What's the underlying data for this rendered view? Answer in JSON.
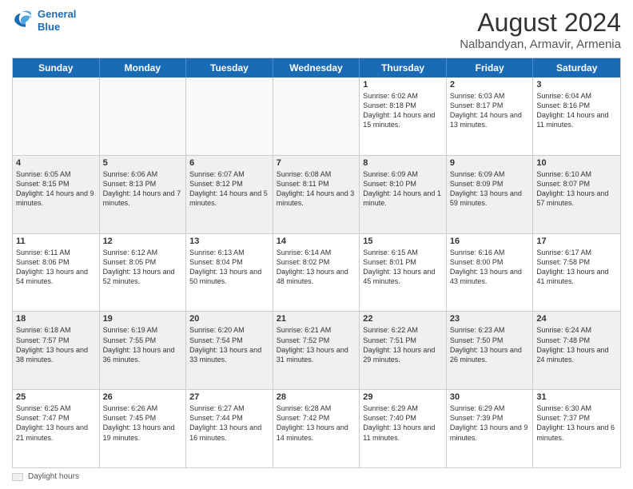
{
  "logo": {
    "line1": "General",
    "line2": "Blue"
  },
  "title": "August 2024",
  "subtitle": "Nalbandyan, Armavir, Armenia",
  "days_of_week": [
    "Sunday",
    "Monday",
    "Tuesday",
    "Wednesday",
    "Thursday",
    "Friday",
    "Saturday"
  ],
  "footer": {
    "daylight_label": "Daylight hours"
  },
  "weeks": [
    [
      {
        "day": "",
        "text": "",
        "empty": true
      },
      {
        "day": "",
        "text": "",
        "empty": true
      },
      {
        "day": "",
        "text": "",
        "empty": true
      },
      {
        "day": "",
        "text": "",
        "empty": true
      },
      {
        "day": "1",
        "text": "Sunrise: 6:02 AM\nSunset: 8:18 PM\nDaylight: 14 hours and 15 minutes.",
        "empty": false
      },
      {
        "day": "2",
        "text": "Sunrise: 6:03 AM\nSunset: 8:17 PM\nDaylight: 14 hours and 13 minutes.",
        "empty": false
      },
      {
        "day": "3",
        "text": "Sunrise: 6:04 AM\nSunset: 8:16 PM\nDaylight: 14 hours and 11 minutes.",
        "empty": false
      }
    ],
    [
      {
        "day": "4",
        "text": "Sunrise: 6:05 AM\nSunset: 8:15 PM\nDaylight: 14 hours and 9 minutes.",
        "empty": false
      },
      {
        "day": "5",
        "text": "Sunrise: 6:06 AM\nSunset: 8:13 PM\nDaylight: 14 hours and 7 minutes.",
        "empty": false
      },
      {
        "day": "6",
        "text": "Sunrise: 6:07 AM\nSunset: 8:12 PM\nDaylight: 14 hours and 5 minutes.",
        "empty": false
      },
      {
        "day": "7",
        "text": "Sunrise: 6:08 AM\nSunset: 8:11 PM\nDaylight: 14 hours and 3 minutes.",
        "empty": false
      },
      {
        "day": "8",
        "text": "Sunrise: 6:09 AM\nSunset: 8:10 PM\nDaylight: 14 hours and 1 minute.",
        "empty": false
      },
      {
        "day": "9",
        "text": "Sunrise: 6:09 AM\nSunset: 8:09 PM\nDaylight: 13 hours and 59 minutes.",
        "empty": false
      },
      {
        "day": "10",
        "text": "Sunrise: 6:10 AM\nSunset: 8:07 PM\nDaylight: 13 hours and 57 minutes.",
        "empty": false
      }
    ],
    [
      {
        "day": "11",
        "text": "Sunrise: 6:11 AM\nSunset: 8:06 PM\nDaylight: 13 hours and 54 minutes.",
        "empty": false
      },
      {
        "day": "12",
        "text": "Sunrise: 6:12 AM\nSunset: 8:05 PM\nDaylight: 13 hours and 52 minutes.",
        "empty": false
      },
      {
        "day": "13",
        "text": "Sunrise: 6:13 AM\nSunset: 8:04 PM\nDaylight: 13 hours and 50 minutes.",
        "empty": false
      },
      {
        "day": "14",
        "text": "Sunrise: 6:14 AM\nSunset: 8:02 PM\nDaylight: 13 hours and 48 minutes.",
        "empty": false
      },
      {
        "day": "15",
        "text": "Sunrise: 6:15 AM\nSunset: 8:01 PM\nDaylight: 13 hours and 45 minutes.",
        "empty": false
      },
      {
        "day": "16",
        "text": "Sunrise: 6:16 AM\nSunset: 8:00 PM\nDaylight: 13 hours and 43 minutes.",
        "empty": false
      },
      {
        "day": "17",
        "text": "Sunrise: 6:17 AM\nSunset: 7:58 PM\nDaylight: 13 hours and 41 minutes.",
        "empty": false
      }
    ],
    [
      {
        "day": "18",
        "text": "Sunrise: 6:18 AM\nSunset: 7:57 PM\nDaylight: 13 hours and 38 minutes.",
        "empty": false
      },
      {
        "day": "19",
        "text": "Sunrise: 6:19 AM\nSunset: 7:55 PM\nDaylight: 13 hours and 36 minutes.",
        "empty": false
      },
      {
        "day": "20",
        "text": "Sunrise: 6:20 AM\nSunset: 7:54 PM\nDaylight: 13 hours and 33 minutes.",
        "empty": false
      },
      {
        "day": "21",
        "text": "Sunrise: 6:21 AM\nSunset: 7:52 PM\nDaylight: 13 hours and 31 minutes.",
        "empty": false
      },
      {
        "day": "22",
        "text": "Sunrise: 6:22 AM\nSunset: 7:51 PM\nDaylight: 13 hours and 29 minutes.",
        "empty": false
      },
      {
        "day": "23",
        "text": "Sunrise: 6:23 AM\nSunset: 7:50 PM\nDaylight: 13 hours and 26 minutes.",
        "empty": false
      },
      {
        "day": "24",
        "text": "Sunrise: 6:24 AM\nSunset: 7:48 PM\nDaylight: 13 hours and 24 minutes.",
        "empty": false
      }
    ],
    [
      {
        "day": "25",
        "text": "Sunrise: 6:25 AM\nSunset: 7:47 PM\nDaylight: 13 hours and 21 minutes.",
        "empty": false
      },
      {
        "day": "26",
        "text": "Sunrise: 6:26 AM\nSunset: 7:45 PM\nDaylight: 13 hours and 19 minutes.",
        "empty": false
      },
      {
        "day": "27",
        "text": "Sunrise: 6:27 AM\nSunset: 7:44 PM\nDaylight: 13 hours and 16 minutes.",
        "empty": false
      },
      {
        "day": "28",
        "text": "Sunrise: 6:28 AM\nSunset: 7:42 PM\nDaylight: 13 hours and 14 minutes.",
        "empty": false
      },
      {
        "day": "29",
        "text": "Sunrise: 6:29 AM\nSunset: 7:40 PM\nDaylight: 13 hours and 11 minutes.",
        "empty": false
      },
      {
        "day": "30",
        "text": "Sunrise: 6:29 AM\nSunset: 7:39 PM\nDaylight: 13 hours and 9 minutes.",
        "empty": false
      },
      {
        "day": "31",
        "text": "Sunrise: 6:30 AM\nSunset: 7:37 PM\nDaylight: 13 hours and 6 minutes.",
        "empty": false
      }
    ]
  ]
}
